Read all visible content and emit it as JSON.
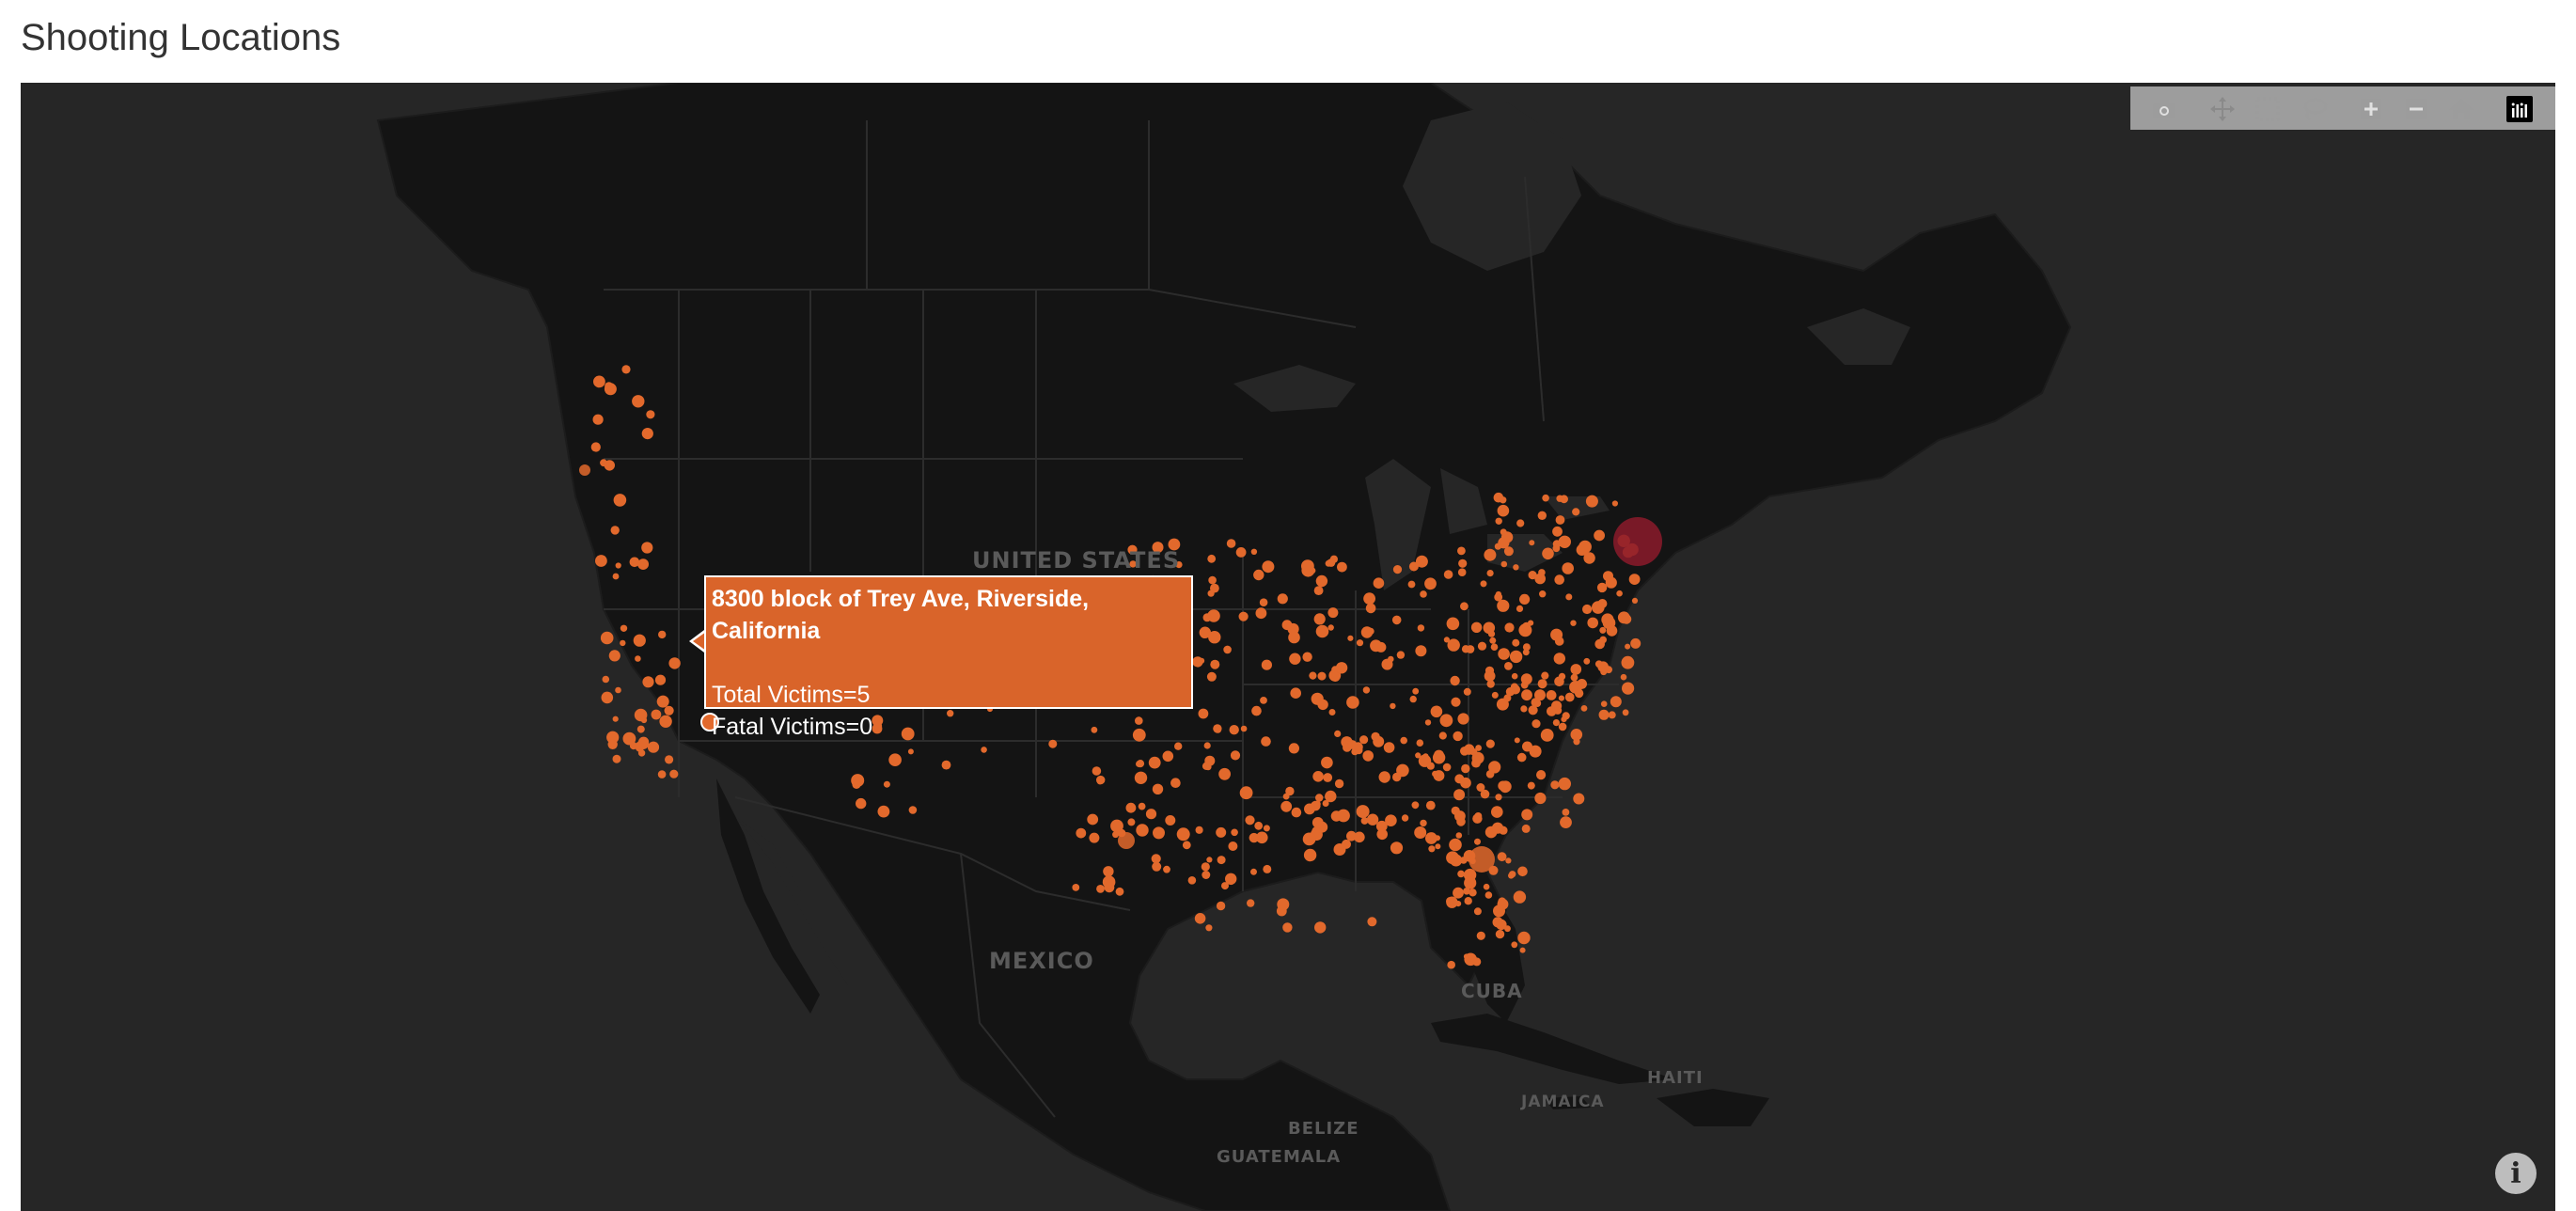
{
  "page": {
    "title": "Shooting Locations"
  },
  "map": {
    "style": "dark basemap",
    "marker_color": "#e2692c",
    "highlight_color": "#8b1a2a",
    "labels": {
      "country_us": "UNITED STATES",
      "country_mx": "MEXICO",
      "cuba": "CUBA",
      "haiti": "HAITI",
      "jamaica": "JAMAICA",
      "belize": "BELIZE",
      "guatemala": "GUATEMALA"
    }
  },
  "modebar": {
    "buttons": [
      {
        "name": "camera-icon",
        "title": "Download plot as a png"
      },
      {
        "name": "pan-icon",
        "title": "Pan"
      },
      {
        "name": "box-select-icon",
        "title": "Box Select"
      },
      {
        "name": "lasso-select-icon",
        "title": "Lasso Select"
      },
      {
        "name": "zoom-in-icon",
        "title": "Zoom in"
      },
      {
        "name": "zoom-out-icon",
        "title": "Zoom out"
      },
      {
        "name": "reset-view-icon",
        "title": "Reset view"
      },
      {
        "name": "plotly-logo-icon",
        "title": "Produced with Plotly"
      }
    ]
  },
  "tooltip": {
    "title": "8300 block of Trey Ave, Riverside, California",
    "line1": "Total Victims=5",
    "line2": "Fatal Victims=0"
  },
  "info_button": {
    "icon": "info-icon",
    "glyph": "i"
  }
}
